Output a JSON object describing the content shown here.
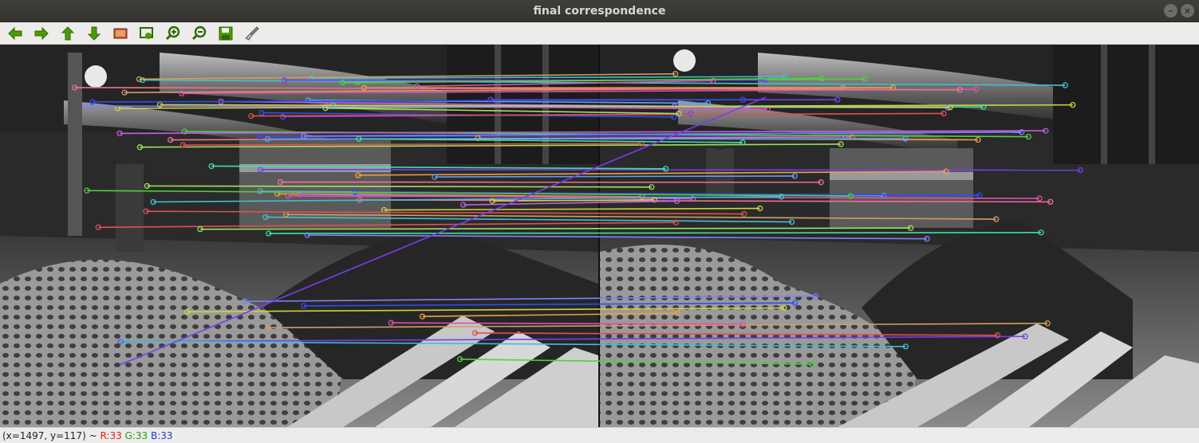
{
  "window": {
    "title": "final correspondence",
    "minimize_glyph": "–",
    "close_glyph": "×"
  },
  "toolbar": {
    "buttons": [
      {
        "name": "pan-left-button",
        "icon": "arrow-left-icon"
      },
      {
        "name": "pan-right-button",
        "icon": "arrow-right-icon"
      },
      {
        "name": "pan-up-button",
        "icon": "arrow-up-icon"
      },
      {
        "name": "pan-down-button",
        "icon": "arrow-down-icon"
      },
      {
        "name": "zoom-fit-button",
        "icon": "image-fit-icon"
      },
      {
        "name": "zoom-original-button",
        "icon": "zoom-original-icon"
      },
      {
        "name": "zoom-in-button",
        "icon": "zoom-in-icon"
      },
      {
        "name": "zoom-out-button",
        "icon": "zoom-out-icon"
      },
      {
        "name": "save-button",
        "icon": "save-icon"
      },
      {
        "name": "properties-button",
        "icon": "brush-icon"
      }
    ]
  },
  "status": {
    "coords": "(x=1497, y=117) ~",
    "r": "R:33",
    "g": "G:33",
    "b": "B:33"
  },
  "colors": {
    "match_palette": [
      "#7a3cf0",
      "#2f4ff0",
      "#e04fb0",
      "#50d040",
      "#f0a040",
      "#40c0d0",
      "#d0d040",
      "#e05050",
      "#a0e060",
      "#60a0f0",
      "#c060e0",
      "#f07090",
      "#40e0a0",
      "#d0a060",
      "#8080ff"
    ]
  }
}
